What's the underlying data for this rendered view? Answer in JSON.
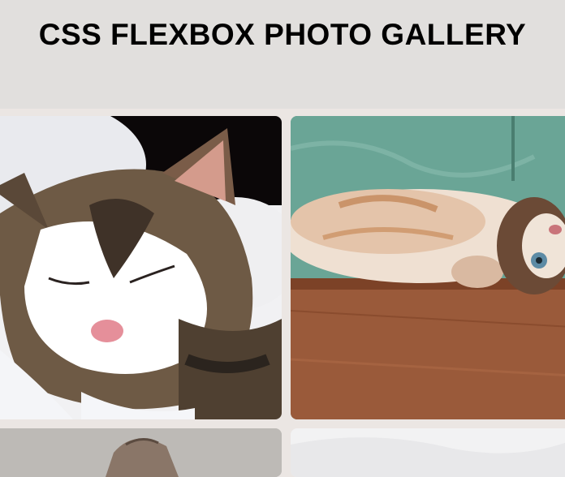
{
  "page": {
    "title": "CSS FLEXBOX PHOTO GALLERY"
  },
  "gallery": {
    "photos": [
      {
        "subject": "sleeping tabby and white cat"
      },
      {
        "subject": "cat lying on wooden floor"
      },
      {
        "subject": "cat (partially visible)"
      },
      {
        "subject": "cat on white blanket (partially visible)"
      }
    ]
  },
  "colors": {
    "header_bg": "#e1dfdd",
    "page_bg": "#ebe6e3",
    "title_text": "#000000"
  }
}
